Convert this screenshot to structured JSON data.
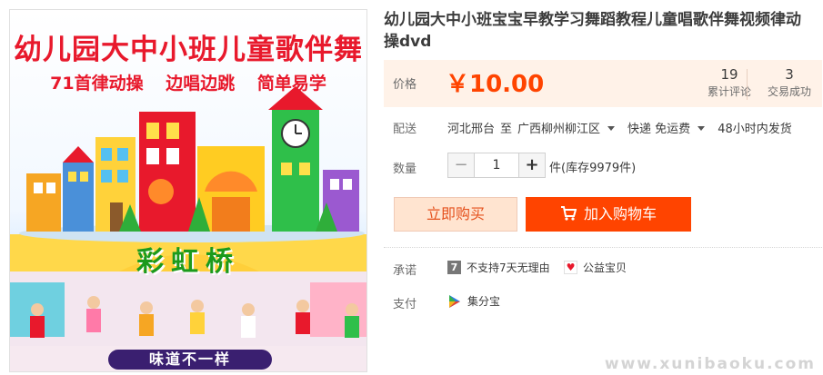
{
  "product_image": {
    "headline": "幼儿园大中小班儿童歌伴舞",
    "taglines": [
      "71首律动操",
      "边唱边跳",
      "简单易学"
    ],
    "center_title": "彩虹桥",
    "banner": "味道不一样"
  },
  "product_title": "幼儿园大中小班宝宝早教学习舞蹈教程儿童唱歌伴舞视频律动操dvd",
  "price": {
    "label": "价格",
    "value": "￥10.00"
  },
  "stats": {
    "reviews_count": "19",
    "reviews_label": "累计评论",
    "sales_count": "3",
    "sales_label": "交易成功"
  },
  "shipping": {
    "label": "配送",
    "origin": "河北邢台",
    "to_word": "至",
    "destination": "广西柳州柳江区",
    "method": "快递 免运费",
    "dispatch": "48小时内发货"
  },
  "quantity": {
    "label": "数量",
    "value": "1",
    "minus": "−",
    "plus": "+",
    "stock": "件(库存9979件)"
  },
  "buttons": {
    "buy_now": "立即购买",
    "add_to_cart": "加入购物车"
  },
  "promise": {
    "label": "承诺",
    "no_return_badge": "7",
    "no_return": "不支持7天无理由",
    "charity": "公益宝贝"
  },
  "payment": {
    "label": "支付",
    "method": "集分宝"
  },
  "watermark": "www.xunibaoku.com",
  "colors": {
    "accent": "#ff4400",
    "price_bg": "#fff2e8",
    "buy_now_bg": "#ffe4d0"
  }
}
